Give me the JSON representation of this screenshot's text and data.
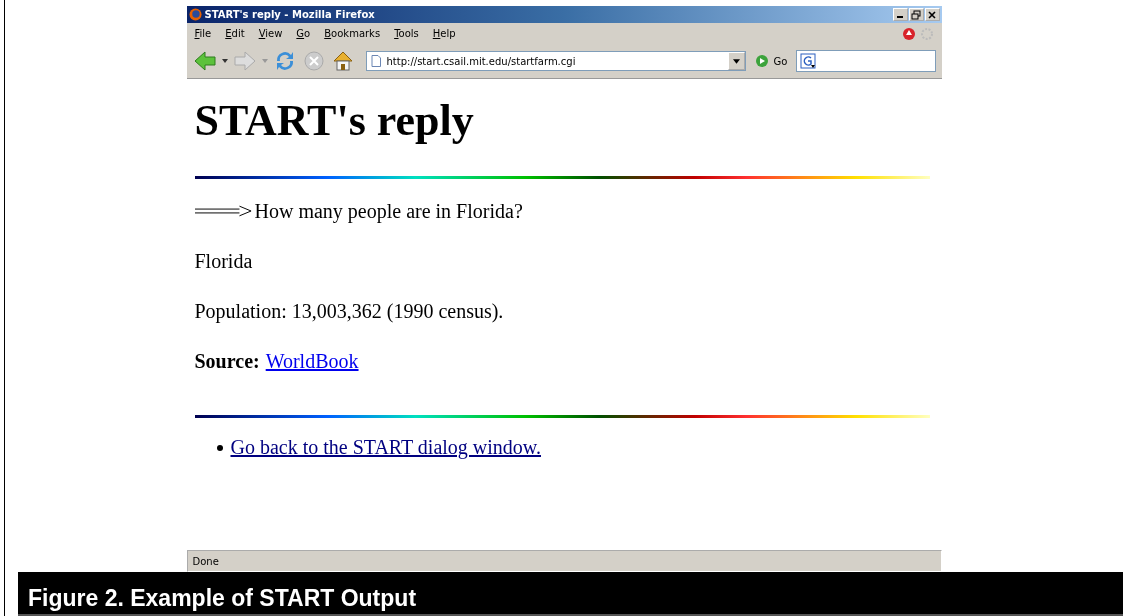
{
  "window": {
    "title": "START's reply - Mozilla Firefox"
  },
  "menu": [
    "File",
    "Edit",
    "View",
    "Go",
    "Bookmarks",
    "Tools",
    "Help"
  ],
  "address": {
    "value": "http://start.csail.mit.edu/startfarm.cgi"
  },
  "go_button": "Go",
  "page": {
    "heading": "START's reply",
    "question": "How many people are in Florida?",
    "entity": "Florida",
    "fact": "Population: 13,003,362 (1990 census).",
    "source_label": "Source:",
    "source_link": "WorldBook",
    "back_link": "Go back to the START dialog window."
  },
  "status_bar": "Done",
  "caption": "Figure 2. Example of START Output"
}
